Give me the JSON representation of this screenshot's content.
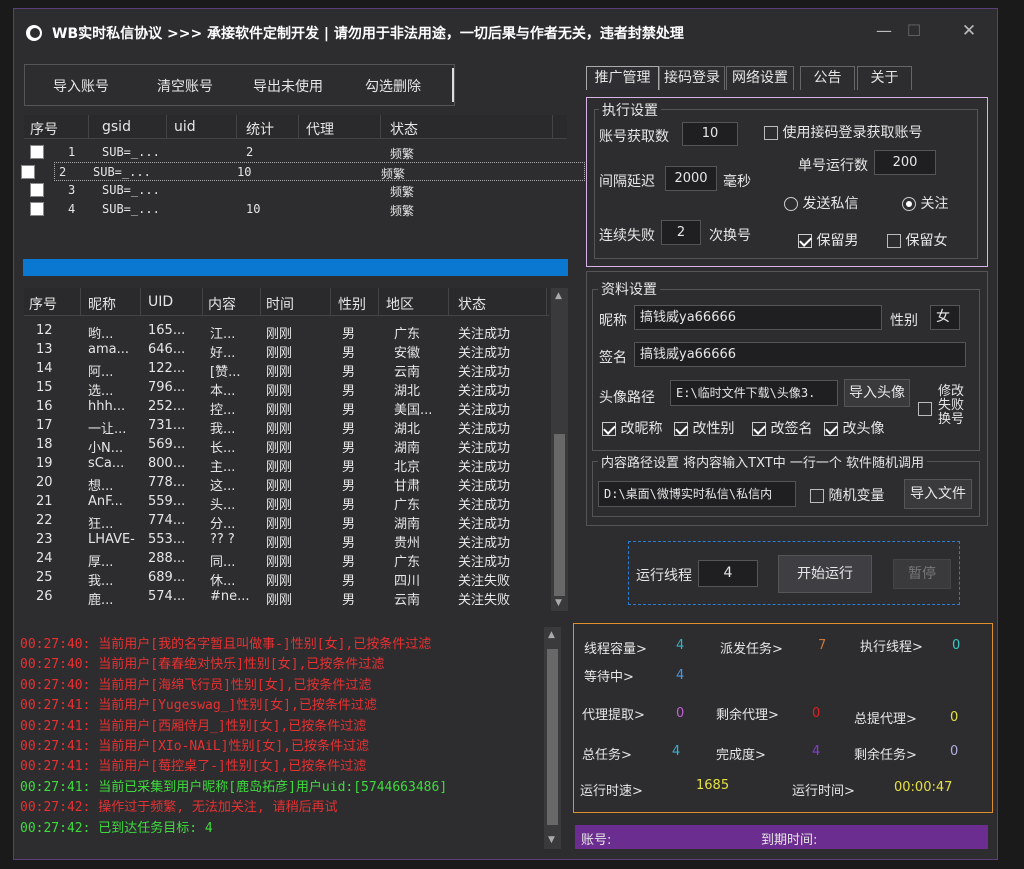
{
  "app": {
    "title": "WB实时私信协议     >>>  承接软件定制开发   |   请勿用于非法用途，一切后果与作者无关，违者封禁处理"
  },
  "window_controls": {
    "minimize": "—",
    "maximize": "☐",
    "close": "✕"
  },
  "account_toolbar": {
    "import": "导入账号",
    "clear": "清空账号",
    "export_unused": "导出未使用",
    "delete_checked": "勾选删除"
  },
  "accounts": {
    "columns": [
      "序号",
      "gsid",
      "uid",
      "统计",
      "代理",
      "状态"
    ],
    "rows": [
      {
        "no": "1",
        "gsid": "SUB=_...",
        "uid": "",
        "count": "2",
        "proxy": "",
        "status": "频繁"
      },
      {
        "no": "2",
        "gsid": "SUB=_...",
        "uid": "",
        "count": "10",
        "proxy": "",
        "status": "频繁"
      },
      {
        "no": "3",
        "gsid": "SUB=_...",
        "uid": "",
        "count": "",
        "proxy": "",
        "status": "频繁"
      },
      {
        "no": "4",
        "gsid": "SUB=_...",
        "uid": "",
        "count": "10",
        "proxy": "",
        "status": "频繁"
      }
    ]
  },
  "progress": {
    "value": 1.0,
    "color": "#0a78d0"
  },
  "results": {
    "columns": [
      "序号",
      "昵称",
      "UID",
      "内容",
      "时间",
      "性别",
      "地区",
      "状态"
    ],
    "rows": [
      {
        "no": "12",
        "nick": "哟...",
        "uid": "165...",
        "content": "江...",
        "time": "刚刚",
        "gender": "男",
        "region": "广东",
        "status": "关注成功"
      },
      {
        "no": "13",
        "nick": "ama...",
        "uid": "646...",
        "content": "好...",
        "time": "刚刚",
        "gender": "男",
        "region": "安徽",
        "status": "关注成功"
      },
      {
        "no": "14",
        "nick": "阿...",
        "uid": "122...",
        "content": "[赞...",
        "time": "刚刚",
        "gender": "男",
        "region": "云南",
        "status": "关注成功"
      },
      {
        "no": "15",
        "nick": "选...",
        "uid": "796...",
        "content": "本...",
        "time": "刚刚",
        "gender": "男",
        "region": "湖北",
        "status": "关注成功"
      },
      {
        "no": "16",
        "nick": "hhh...",
        "uid": "252...",
        "content": "控...",
        "time": "刚刚",
        "gender": "男",
        "region": "美国...",
        "status": "关注成功"
      },
      {
        "no": "17",
        "nick": "一让...",
        "uid": "731...",
        "content": "我...",
        "time": "刚刚",
        "gender": "男",
        "region": "湖北",
        "status": "关注成功"
      },
      {
        "no": "18",
        "nick": "小N...",
        "uid": "569...",
        "content": "长...",
        "time": "刚刚",
        "gender": "男",
        "region": "湖南",
        "status": "关注成功"
      },
      {
        "no": "19",
        "nick": "sCa...",
        "uid": "800...",
        "content": "主...",
        "time": "刚刚",
        "gender": "男",
        "region": "北京",
        "status": "关注成功"
      },
      {
        "no": "20",
        "nick": "想...",
        "uid": "778...",
        "content": "这...",
        "time": "刚刚",
        "gender": "男",
        "region": "甘肃",
        "status": "关注成功"
      },
      {
        "no": "21",
        "nick": "AnF...",
        "uid": "559...",
        "content": "头...",
        "time": "刚刚",
        "gender": "男",
        "region": "广东",
        "status": "关注成功"
      },
      {
        "no": "22",
        "nick": "狂...",
        "uid": "774...",
        "content": "分...",
        "time": "刚刚",
        "gender": "男",
        "region": "湖南",
        "status": "关注成功"
      },
      {
        "no": "23",
        "nick": "LHAVE-",
        "uid": "553...",
        "content": "??  ?",
        "time": "刚刚",
        "gender": "男",
        "region": "贵州",
        "status": "关注成功"
      },
      {
        "no": "24",
        "nick": "厚...",
        "uid": "288...",
        "content": "同...",
        "time": "刚刚",
        "gender": "男",
        "region": "广东",
        "status": "关注成功"
      },
      {
        "no": "25",
        "nick": "我...",
        "uid": "689...",
        "content": "休...",
        "time": "刚刚",
        "gender": "男",
        "region": "四川",
        "status": "关注失败"
      },
      {
        "no": "26",
        "nick": "鹿...",
        "uid": "574...",
        "content": "#ne...",
        "time": "刚刚",
        "gender": "男",
        "region": "云南",
        "status": "关注失败"
      }
    ]
  },
  "log": [
    {
      "text": "00:27:40: 当前用户[我的名字暂且叫做事-]性别[女],已按条件过滤",
      "color": "#e83030"
    },
    {
      "text": "00:27:40: 当前用户[春春绝对快乐]性别[女],已按条件过滤",
      "color": "#e83030"
    },
    {
      "text": "00:27:40: 当前用户[海绵飞行员]性别[女],已按条件过滤",
      "color": "#e83030"
    },
    {
      "text": "00:27:41: 当前用户[Yugeswag_]性别[女],已按条件过滤",
      "color": "#e83030"
    },
    {
      "text": "00:27:41: 当前用户[西厢侍月_]性别[女],已按条件过滤",
      "color": "#e83030"
    },
    {
      "text": "00:27:41: 当前用户[XIo-NAiL]性别[女],已按条件过滤",
      "color": "#e83030"
    },
    {
      "text": "00:27:41: 当前用户[莓控桌了-]性别[女],已按条件过滤",
      "color": "#e83030"
    },
    {
      "text": "00:27:41: 当前已采集到用户昵称[鹿岛拓彦]用户uid:[5744663486]",
      "color": "#3ddc3d"
    },
    {
      "text": "00:27:42: 操作过于频繁, 无法加关注, 请稍后再试",
      "color": "#e83030"
    },
    {
      "text": "00:27:42: 已到达任务目标: 4",
      "color": "#3ddc3d"
    }
  ],
  "tabs": [
    "推广管理",
    "接码登录",
    "网络设置",
    "公告",
    "关于"
  ],
  "exec": {
    "group": "执行设置",
    "account_fetch_label": "账号获取数",
    "account_fetch_value": "10",
    "use_sms_login": "使用接码登录获取账号",
    "single_run_label": "单号运行数",
    "single_run_value": "200",
    "delay_label": "间隔延迟",
    "delay_value": "2000",
    "delay_unit": "毫秒",
    "send_dm": "发送私信",
    "follow": "关注",
    "fail_label": "连续失败",
    "fail_value": "2",
    "fail_unit": "次换号",
    "keep_male": "保留男",
    "keep_female": "保留女"
  },
  "profile": {
    "group": "资料设置",
    "nick_label": "昵称",
    "nick_value": "搞钱威ya66666",
    "gender_label": "性别",
    "gender_value": "女",
    "sign_label": "签名",
    "sign_value": "搞钱威ya66666",
    "avatar_label": "头像路径",
    "avatar_value": "E:\\临时文件下载\\头像3.",
    "import_avatar": "导入头像",
    "modify_fail_swap": "修改失败换号",
    "mod_nick": "改昵称",
    "mod_gender": "改性别",
    "mod_sign": "改签名",
    "mod_avatar": "改头像"
  },
  "content_path": {
    "group": "内容路径设置 将内容输入TXT中 一行一个 软件随机调用",
    "path_value": "D:\\桌面\\微博实时私信\\私信内",
    "random_var": "随机变量",
    "import_file": "导入文件"
  },
  "run": {
    "threads_label": "运行线程",
    "threads_value": "4",
    "start": "开始运行",
    "pause": "暂停"
  },
  "stats": {
    "capacity_label": "线程容量>",
    "capacity": "4",
    "dispatch_label": "派发任务>",
    "dispatch": "7",
    "exec_threads_label": "执行线程>",
    "exec_threads": "0",
    "waiting_label": "等待中>",
    "waiting": "4",
    "proxy_fetch_label": "代理提取>",
    "proxy_fetch": "0",
    "proxy_left_label": "剩余代理>",
    "proxy_left": "0",
    "proxy_total_label": "总提代理>",
    "proxy_total": "0",
    "total_label": "总任务>",
    "total": "4",
    "done_label": "完成度>",
    "done": "4",
    "left_label": "剩余任务>",
    "left": "0",
    "speed_label": "运行时速>",
    "speed": "1685",
    "time_label": "运行时间>",
    "time": "00:00:47"
  },
  "footer": {
    "account_label": "账号:",
    "expire_label": "到期时间:"
  }
}
